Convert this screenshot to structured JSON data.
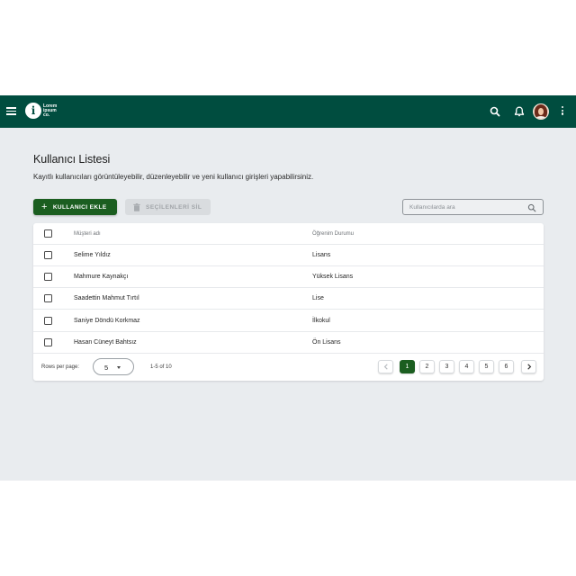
{
  "app": {
    "logo_mark": "i",
    "logo_lines": [
      "Lorem",
      "ipsum",
      "co."
    ]
  },
  "header": {
    "title": "Kullanıcı Listesi",
    "subtitle": "Kayıtlı kullanıcıları görüntüleyebilir, düzenleyebilir ve yeni kullanıcı girişleri yapabilirsiniz."
  },
  "toolbar": {
    "add_icon": "plus-icon",
    "add_label": "KULLANICI EKLE",
    "delete_icon": "trash-icon",
    "delete_label": "SEÇİLENLERİ SİL",
    "search_placeholder": "Kullanıcılarda ara",
    "search_value": ""
  },
  "table": {
    "columns": [
      "Müşteri adı",
      "Öğrenim Durumu"
    ],
    "rows": [
      {
        "name": "Selime Yıldız",
        "education": "Lisans"
      },
      {
        "name": "Mahmure Kaynakçı",
        "education": "Yüksek Lisans"
      },
      {
        "name": "Saadettin Mahmut Tırtıl",
        "education": "Lise"
      },
      {
        "name": "Saniye Döndü Korkmaz",
        "education": "İlkokul"
      },
      {
        "name": "Hasan Cüneyt Bahtsız",
        "education": "Ön Lisans"
      }
    ]
  },
  "pagination": {
    "rows_per_page_label": "Rows per page:",
    "rows_per_page_value": "5",
    "range_text": "1-5 of 10",
    "pages": [
      "1",
      "2",
      "3",
      "4",
      "5",
      "6"
    ],
    "current_page": "1"
  },
  "colors": {
    "appbar": "#004d3f",
    "primary": "#1b5e20",
    "background": "#e9ecef"
  }
}
